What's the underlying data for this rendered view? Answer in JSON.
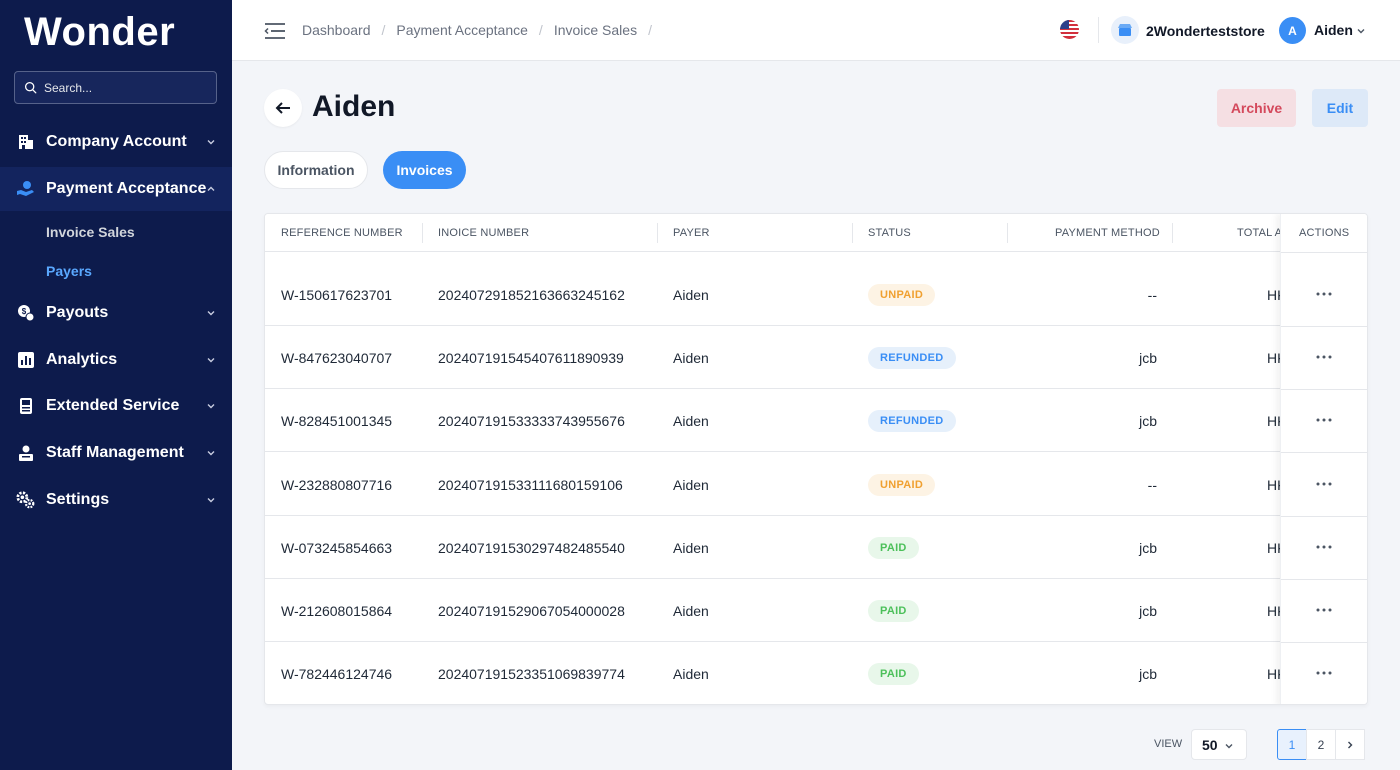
{
  "app": {
    "logo": "Wonder"
  },
  "sidebar": {
    "search_placeholder": "Search...",
    "items": [
      {
        "label": "Company Account",
        "icon": "building-icon"
      },
      {
        "label": "Payment Acceptance",
        "icon": "hand-coin-icon"
      },
      {
        "label": "Payouts",
        "icon": "coins-icon"
      },
      {
        "label": "Analytics",
        "icon": "bar-chart-icon"
      },
      {
        "label": "Extended Service",
        "icon": "pos-terminal-icon"
      },
      {
        "label": "Staff Management",
        "icon": "staff-icon"
      },
      {
        "label": "Settings",
        "icon": "gears-icon"
      }
    ],
    "sub_items": [
      "Invoice Sales",
      "Payers"
    ]
  },
  "topbar": {
    "breadcrumb": [
      "Dashboard",
      "Payment Acceptance",
      "Invoice Sales"
    ],
    "store_name": "2Wonderteststore",
    "user_initial": "A",
    "user_name": "Aiden"
  },
  "page": {
    "title": "Aiden",
    "archive_label": "Archive",
    "edit_label": "Edit",
    "tabs": [
      "Information",
      "Invoices"
    ]
  },
  "table": {
    "columns": [
      "REFERENCE NUMBER",
      "INOICE NUMBER",
      "PAYER",
      "STATUS",
      "PAYMENT METHOD",
      "TOTAL A",
      "ACTIONS"
    ],
    "rows": [
      {
        "ref": "W-150617623701",
        "invoice": "20240729185216366324516​2",
        "payer": "Aiden",
        "status": "UNPAID",
        "method": "--",
        "total": "HK"
      },
      {
        "ref": "W-847623040707",
        "invoice": "20240719154540761189093​9",
        "payer": "Aiden",
        "status": "REFUNDED",
        "method": "jcb",
        "total": "HK"
      },
      {
        "ref": "W-828451001345",
        "invoice": "20240719153333374395567​6",
        "payer": "Aiden",
        "status": "REFUNDED",
        "method": "jcb",
        "total": "HK"
      },
      {
        "ref": "W-232880807716",
        "invoice": "20240719153311168015910​6",
        "payer": "Aiden",
        "status": "UNPAID",
        "method": "--",
        "total": "HK"
      },
      {
        "ref": "W-073245854663",
        "invoice": "20240719153029748248554​0",
        "payer": "Aiden",
        "status": "PAID",
        "method": "jcb",
        "total": "HK"
      },
      {
        "ref": "W-212608015864",
        "invoice": "20240719152906705400002​8",
        "payer": "Aiden",
        "status": "PAID",
        "method": "jcb",
        "total": "HK"
      },
      {
        "ref": "W-782446124746",
        "invoice": "20240719152335106983977​4",
        "payer": "Aiden",
        "status": "PAID",
        "method": "jcb",
        "total": "HK"
      }
    ]
  },
  "footer": {
    "view_label": "VIEW",
    "view_value": "50",
    "pages": [
      "1",
      "2"
    ]
  },
  "colors": {
    "sidebar_bg": "#0d1b4c",
    "accent": "#3a8ef5",
    "unpaid": "#f0a030",
    "refunded": "#3a8ef5",
    "paid": "#4cc05a",
    "archive": "#d4495c"
  }
}
